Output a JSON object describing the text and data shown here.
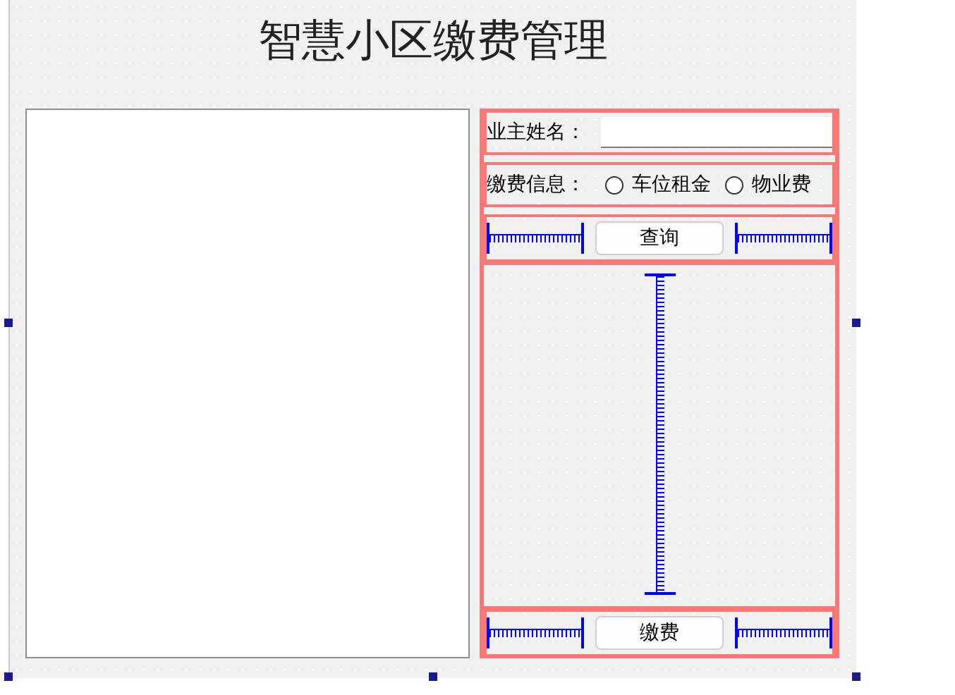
{
  "window": {
    "title": "智慧小区缴费管理"
  },
  "name_field": {
    "label": "业主姓名："
  },
  "fee_type": {
    "label": "缴费信息：",
    "options": [
      {
        "label": "车位租金",
        "selected": false
      },
      {
        "label": "物业费",
        "selected": false
      }
    ]
  },
  "query_button": {
    "label": "查询"
  },
  "pay_button": {
    "label": "缴费"
  }
}
